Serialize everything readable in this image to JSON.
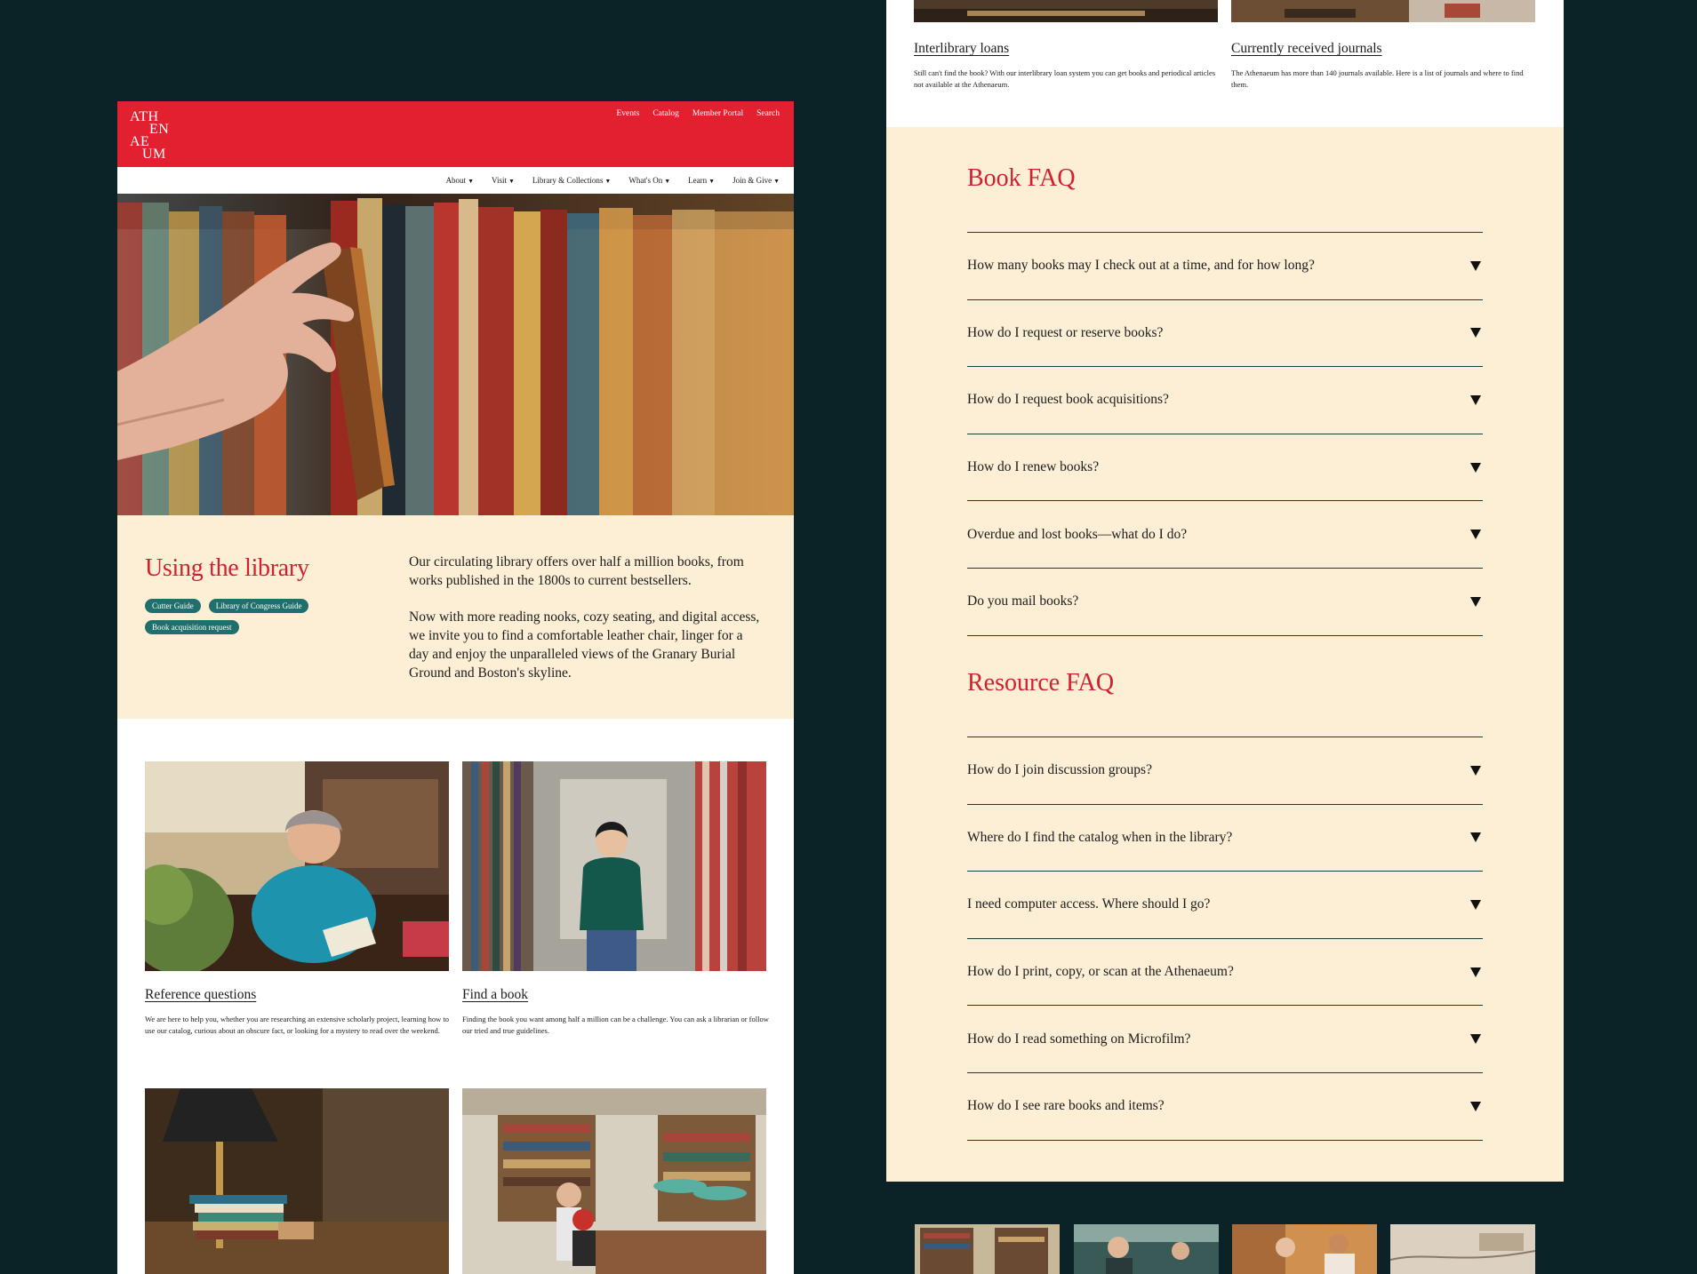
{
  "left": {
    "logo": {
      "l1": "ATH",
      "l2": "EN",
      "l3": "AE",
      "l4": "UM"
    },
    "utility_nav": [
      "Events",
      "Catalog",
      "Member Portal",
      "Search"
    ],
    "main_nav": [
      "About",
      "Visit",
      "Library & Collections",
      "What's On",
      "Learn",
      "Join & Give"
    ],
    "intro": {
      "title": "Using the library",
      "tags": [
        "Cutter Guide",
        "Library of Congress Guide",
        "Book acquisition request"
      ],
      "paragraphs": [
        "Our circulating library offers over half a million books, from works published in the 1800s to current bestsellers.",
        "Now with more reading nooks, cozy seating, and digital access, we invite you to find a comfortable leather chair, linger for a day and enjoy the unparalleled views of the Granary Burial Ground and Boston's skyline."
      ]
    },
    "cards": [
      {
        "title": "Reference questions",
        "desc": "We are here to help you, whether you are researching an extensive scholarly project, learning how to use our catalog, curious about an obscure fact, or looking for a mystery to read over the weekend."
      },
      {
        "title": "Find a book",
        "desc": "Finding the book you want among half a million can be a challenge. You can ask a librarian or follow our tried and true guidelines."
      }
    ]
  },
  "right": {
    "top_cards": [
      {
        "title": "Interlibrary loans",
        "desc": "Still can't find the book? With our interlibrary loan system you can get books and periodical articles not available at the Athenaeum."
      },
      {
        "title": "Currently received journals",
        "desc": "The Athenaeum has more than 140 journals available. Here is a list of journals and where to find them."
      }
    ],
    "book_faq": {
      "heading": "Book FAQ",
      "items": [
        "How many books may I check out at a time, and for how long?",
        "How do I request or reserve books?",
        "How do I request book acquisitions?",
        "How do I renew books?",
        "Overdue and lost books—what do I do?",
        "Do you mail books?"
      ]
    },
    "resource_faq": {
      "heading": "Resource FAQ",
      "items": [
        "How do I join discussion groups?",
        "Where do I find the catalog when in the library?",
        "I need computer access. Where should I go?",
        "How do I print, copy, or scan at the Athenaeum?",
        "How do I read something on Microfilm?",
        "How do I see rare books and items?"
      ]
    }
  },
  "colors": {
    "background": "#0b2326",
    "brand_red": "#e3202f",
    "cream": "#fcefd5",
    "teal": "#1f6f6c"
  }
}
